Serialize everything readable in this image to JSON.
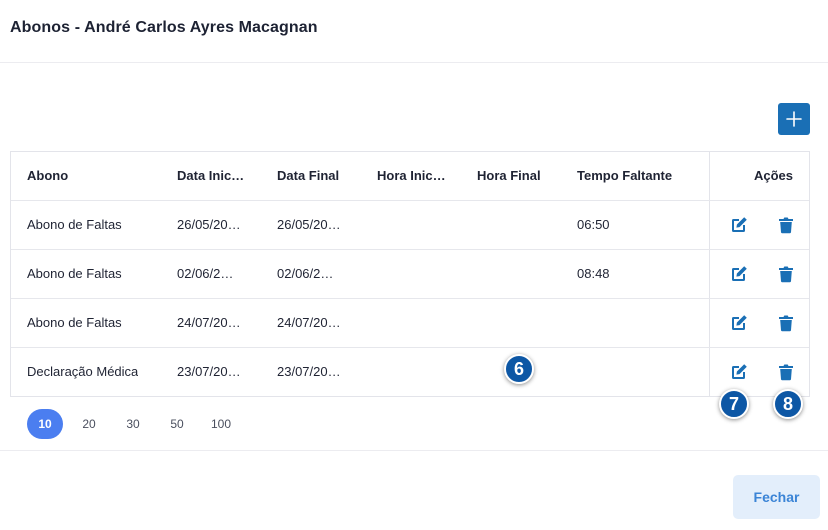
{
  "modal": {
    "title": "Abonos - André Carlos Ayres Macagnan",
    "close_label": "Fechar"
  },
  "toolbar": {
    "add_icon": "plus-icon"
  },
  "table": {
    "headers": [
      "Abono",
      "Data Inic…",
      "Data Final",
      "Hora Inic…",
      "Hora Final",
      "Tempo Faltante",
      "Ações"
    ],
    "rows": [
      {
        "abono": "Abono de Faltas",
        "data_inicial": "26/05/20…",
        "data_final": "26/05/20…",
        "hora_inicial": "",
        "hora_final": "",
        "tempo_faltante": "06:50"
      },
      {
        "abono": "Abono de Faltas",
        "data_inicial": "02/06/2…",
        "data_final": "02/06/2…",
        "hora_inicial": "",
        "hora_final": "",
        "tempo_faltante": "08:48"
      },
      {
        "abono": "Abono de Faltas",
        "data_inicial": "24/07/20…",
        "data_final": "24/07/20…",
        "hora_inicial": "",
        "hora_final": "",
        "tempo_faltante": ""
      },
      {
        "abono": "Declaração Médica",
        "data_inicial": "23/07/20…",
        "data_final": "23/07/20…",
        "hora_inicial": "",
        "hora_final": "",
        "tempo_faltante": ""
      }
    ],
    "edit_icon": "edit-icon",
    "delete_icon": "trash-icon"
  },
  "pagination": {
    "sizes": [
      "10",
      "20",
      "30",
      "50",
      "100"
    ],
    "selected": "10"
  },
  "annotations": {
    "badge_6": "6",
    "badge_7": "7",
    "badge_8": "8"
  },
  "colors": {
    "primary": "#1a6fb5",
    "active_page": "#4b7ef0",
    "badge": "#0d57a5",
    "close_bg": "#e3eefb",
    "close_text": "#3b84d6"
  }
}
